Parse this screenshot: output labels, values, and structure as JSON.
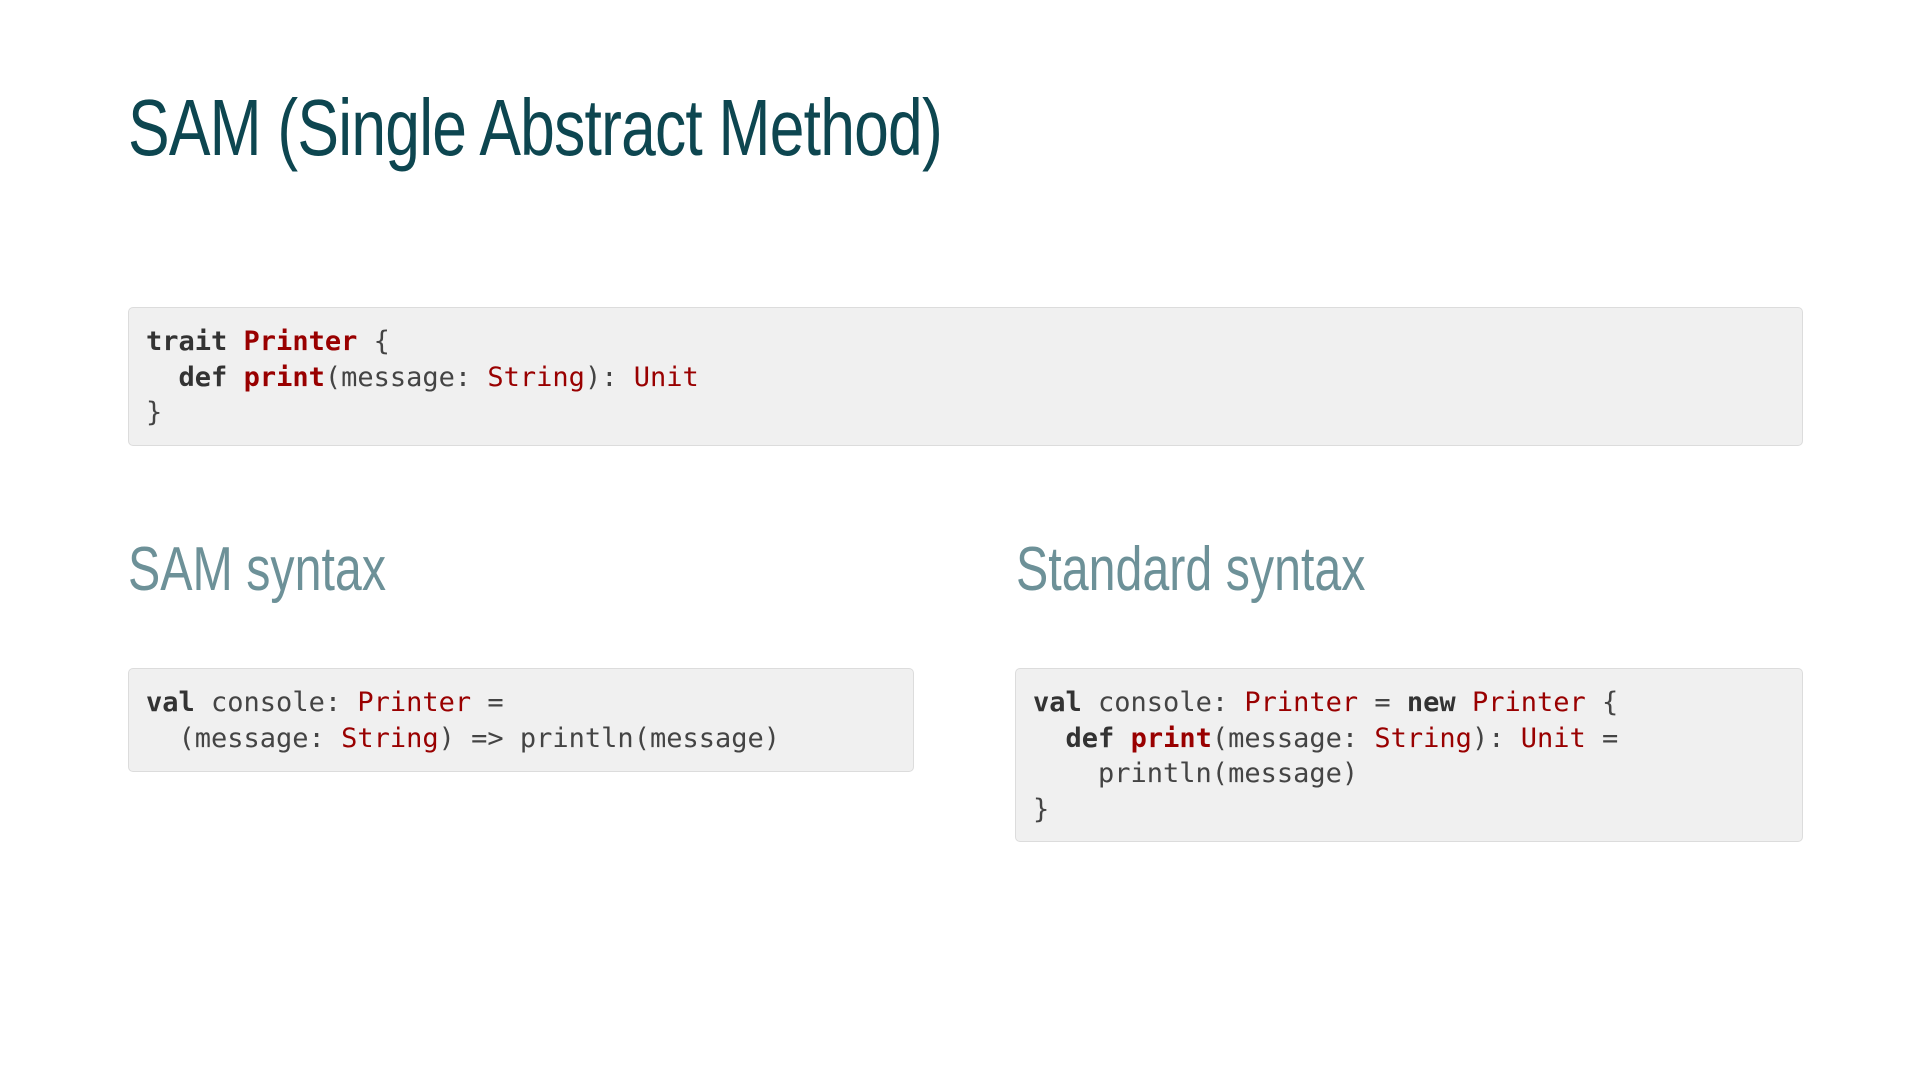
{
  "slide": {
    "title": "SAM (Single Abstract Method)",
    "left_heading": "SAM syntax",
    "right_heading": "Standard syntax"
  },
  "colors": {
    "title": "#0d4650",
    "heading": "#6d9198",
    "code_background": "#f0f0f0",
    "keyword": "#333333",
    "type": "#990000",
    "plain": "#444444"
  },
  "code_top": {
    "lines": [
      [
        {
          "t": "trait",
          "k": "kw"
        },
        {
          "t": " ",
          "k": "pl"
        },
        {
          "t": "Printer",
          "k": "fn"
        },
        {
          "t": " {",
          "k": "pl"
        }
      ],
      [
        {
          "t": "  ",
          "k": "pl"
        },
        {
          "t": "def",
          "k": "kw"
        },
        {
          "t": " ",
          "k": "pl"
        },
        {
          "t": "print",
          "k": "fn"
        },
        {
          "t": "(message: ",
          "k": "pl"
        },
        {
          "t": "String",
          "k": "ty"
        },
        {
          "t": "): ",
          "k": "pl"
        },
        {
          "t": "Unit",
          "k": "ty"
        }
      ],
      [
        {
          "t": "}",
          "k": "pl"
        }
      ]
    ]
  },
  "code_left": {
    "lines": [
      [
        {
          "t": "val",
          "k": "kw"
        },
        {
          "t": " console: ",
          "k": "pl"
        },
        {
          "t": "Printer",
          "k": "ty"
        },
        {
          "t": " =",
          "k": "pl"
        }
      ],
      [
        {
          "t": "  (message: ",
          "k": "pl"
        },
        {
          "t": "String",
          "k": "ty"
        },
        {
          "t": ") => println(message)",
          "k": "pl"
        }
      ]
    ]
  },
  "code_right": {
    "lines": [
      [
        {
          "t": "val",
          "k": "kw"
        },
        {
          "t": " console: ",
          "k": "pl"
        },
        {
          "t": "Printer",
          "k": "ty"
        },
        {
          "t": " = ",
          "k": "pl"
        },
        {
          "t": "new",
          "k": "kw"
        },
        {
          "t": " ",
          "k": "pl"
        },
        {
          "t": "Printer",
          "k": "ty"
        },
        {
          "t": " {",
          "k": "pl"
        }
      ],
      [
        {
          "t": "  ",
          "k": "pl"
        },
        {
          "t": "def",
          "k": "kw"
        },
        {
          "t": " ",
          "k": "pl"
        },
        {
          "t": "print",
          "k": "fn"
        },
        {
          "t": "(message: ",
          "k": "pl"
        },
        {
          "t": "String",
          "k": "ty"
        },
        {
          "t": "): ",
          "k": "pl"
        },
        {
          "t": "Unit",
          "k": "ty"
        },
        {
          "t": " =",
          "k": "pl"
        }
      ],
      [
        {
          "t": "    println(message)",
          "k": "pl"
        }
      ],
      [
        {
          "t": "}",
          "k": "pl"
        }
      ]
    ]
  }
}
